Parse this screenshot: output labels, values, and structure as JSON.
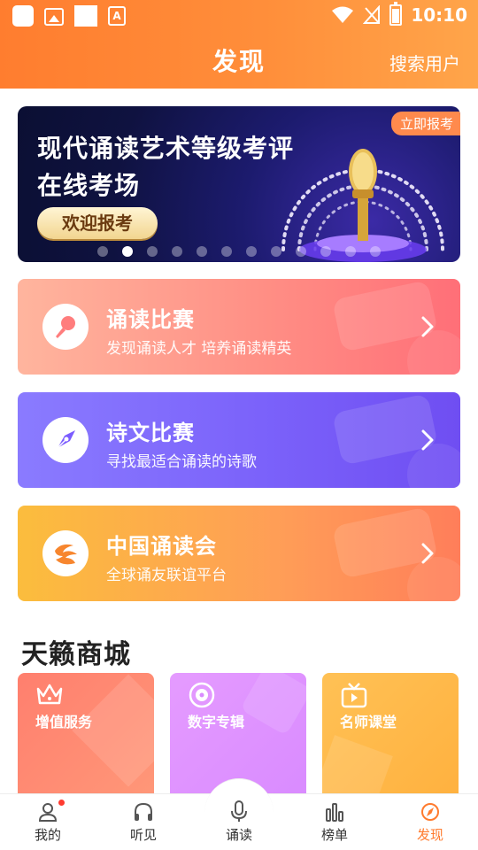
{
  "status_bar": {
    "time": "10:10"
  },
  "header": {
    "title": "发现",
    "action": "搜索用户"
  },
  "banner": {
    "tag": "立即报考",
    "line1": "现代诵读艺术等级考评",
    "line2": "在线考场",
    "button": "欢迎报考",
    "slides": 12,
    "active_slide": 2
  },
  "cards": [
    {
      "title": "诵读比赛",
      "subtitle": "发现诵读人才  培养诵读精英",
      "icon": "microphone-icon"
    },
    {
      "title": "诗文比赛",
      "subtitle": "寻找最适合诵读的诗歌",
      "icon": "pen-nib-icon"
    },
    {
      "title": "中国诵读会",
      "subtitle": "全球诵友联谊平台",
      "icon": "swirl-logo-icon"
    }
  ],
  "mall": {
    "title": "天籁商城",
    "items": [
      {
        "label": "增值服务",
        "icon": "crown-icon"
      },
      {
        "label": "数字专辑",
        "icon": "disc-icon"
      },
      {
        "label": "名师课堂",
        "icon": "tv-icon"
      }
    ]
  },
  "nav": {
    "items": [
      {
        "label": "我的",
        "icon": "user-icon"
      },
      {
        "label": "听见",
        "icon": "headphones-icon"
      },
      {
        "label": "诵读",
        "icon": "microphone-icon"
      },
      {
        "label": "榜单",
        "icon": "bar-chart-icon"
      },
      {
        "label": "发现",
        "icon": "compass-icon"
      }
    ],
    "active": "发现"
  },
  "colors": {
    "accent": "#ff7b2e",
    "card_1": "#ff8f85",
    "card_2": "#7b62fa",
    "card_3": "#ff9d57"
  }
}
